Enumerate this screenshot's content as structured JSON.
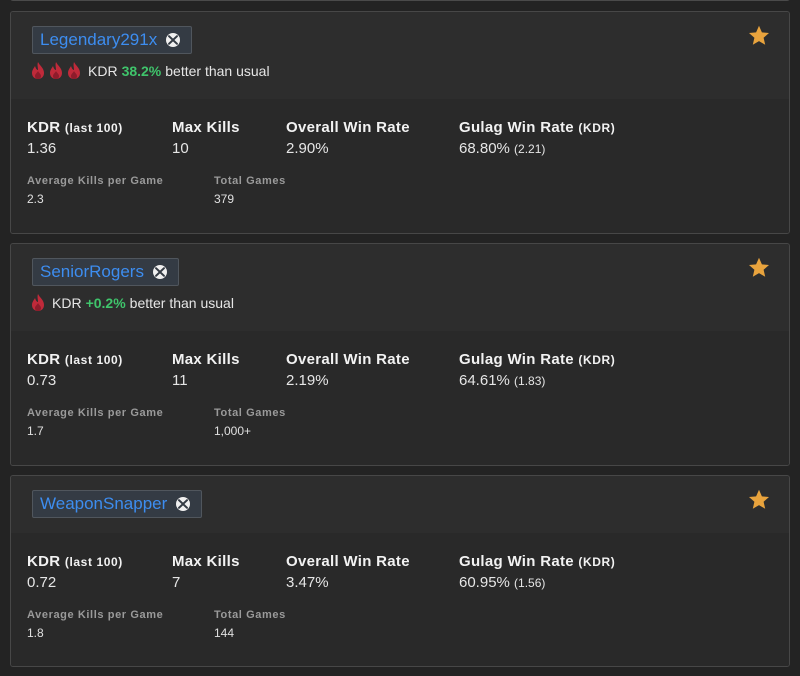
{
  "labels": {
    "kdr": "KDR",
    "kdr_sub": "(last 100)",
    "max_kills": "Max Kills",
    "win_rate": "Overall Win Rate",
    "gulag": "Gulag Win Rate",
    "gulag_sub": "(KDR)",
    "avg_kills": "Average Kills per Game",
    "total_games": "Total Games",
    "trend_prefix": "KDR",
    "trend_suffix": "better than usual"
  },
  "colors": {
    "accent": "#3d8df0",
    "positive": "#3fc46b",
    "star": "#e8a33d",
    "flame": "#c02a3a"
  },
  "players": [
    {
      "name": "Legendary291x",
      "platform_icon": "xbox-icon",
      "favorited": true,
      "flames": 3,
      "trend_pct": "38.2%",
      "kdr": "1.36",
      "max_kills": "10",
      "win_rate": "2.90%",
      "gulag_rate": "68.80%",
      "gulag_kdr": "(2.21)",
      "avg_kills": "2.3",
      "total_games": "379"
    },
    {
      "name": "SeniorRogers",
      "platform_icon": "xbox-icon",
      "favorited": true,
      "flames": 1,
      "trend_pct": "+0.2%",
      "kdr": "0.73",
      "max_kills": "11",
      "win_rate": "2.19%",
      "gulag_rate": "64.61%",
      "gulag_kdr": "(1.83)",
      "avg_kills": "1.7",
      "total_games": "1,000+"
    },
    {
      "name": "WeaponSnapper",
      "platform_icon": "xbox-icon",
      "favorited": true,
      "flames": 0,
      "trend_pct": "",
      "kdr": "0.72",
      "max_kills": "7",
      "win_rate": "3.47%",
      "gulag_rate": "60.95%",
      "gulag_kdr": "(1.56)",
      "avg_kills": "1.8",
      "total_games": "144"
    }
  ]
}
